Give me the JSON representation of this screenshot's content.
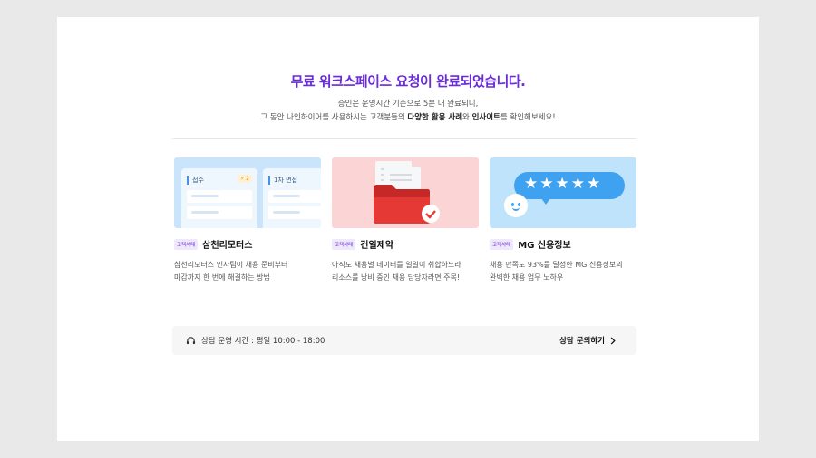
{
  "header": {
    "title": "무료 워크스페이스 요청이 완료되었습니다.",
    "line1": "승인은 운영시간 기준으로 5분 내 완료되니,",
    "line2_a": "그 동안 나인하이어를 사용하시는 고객분들의 ",
    "line2_b": "다양한 활용 사례",
    "line2_c": "와 ",
    "line2_d": "인사이트",
    "line2_e": "를 확인해보세요!"
  },
  "cards": [
    {
      "badge": "고객사례",
      "name": "삼천리모터스",
      "text": "삼천리모터스 인사팀이 채용 준비부터\n마감까지 한 번에 해결하는 방법",
      "thumb": {
        "col1": "접수",
        "col1_tag": "2",
        "col2": "1차 면접"
      }
    },
    {
      "badge": "고객사례",
      "name": "건일제약",
      "text": "아직도 채용별 데이터를 일일이 취합하느라\n리소스를 낭비 중인 채용 담당자라면 주목!"
    },
    {
      "badge": "고객사례",
      "name": "MG 신용정보",
      "text": "채용 만족도 93%를 달성한 MG 신용정보의\n완벽한 채용 업무 노하우",
      "thumb": {
        "stars": "★★★★★"
      }
    }
  ],
  "footer": {
    "hours": "상담 운영 시간 : 평일 10:00 - 18:00",
    "contact": "상담 문의하기"
  },
  "colors": {
    "accent": "#6a2bd9",
    "folder": "#e53935",
    "bubble": "#3fa2f0"
  },
  "icons": {
    "headset": "headset-icon",
    "chevron": "chevron-right-icon"
  }
}
